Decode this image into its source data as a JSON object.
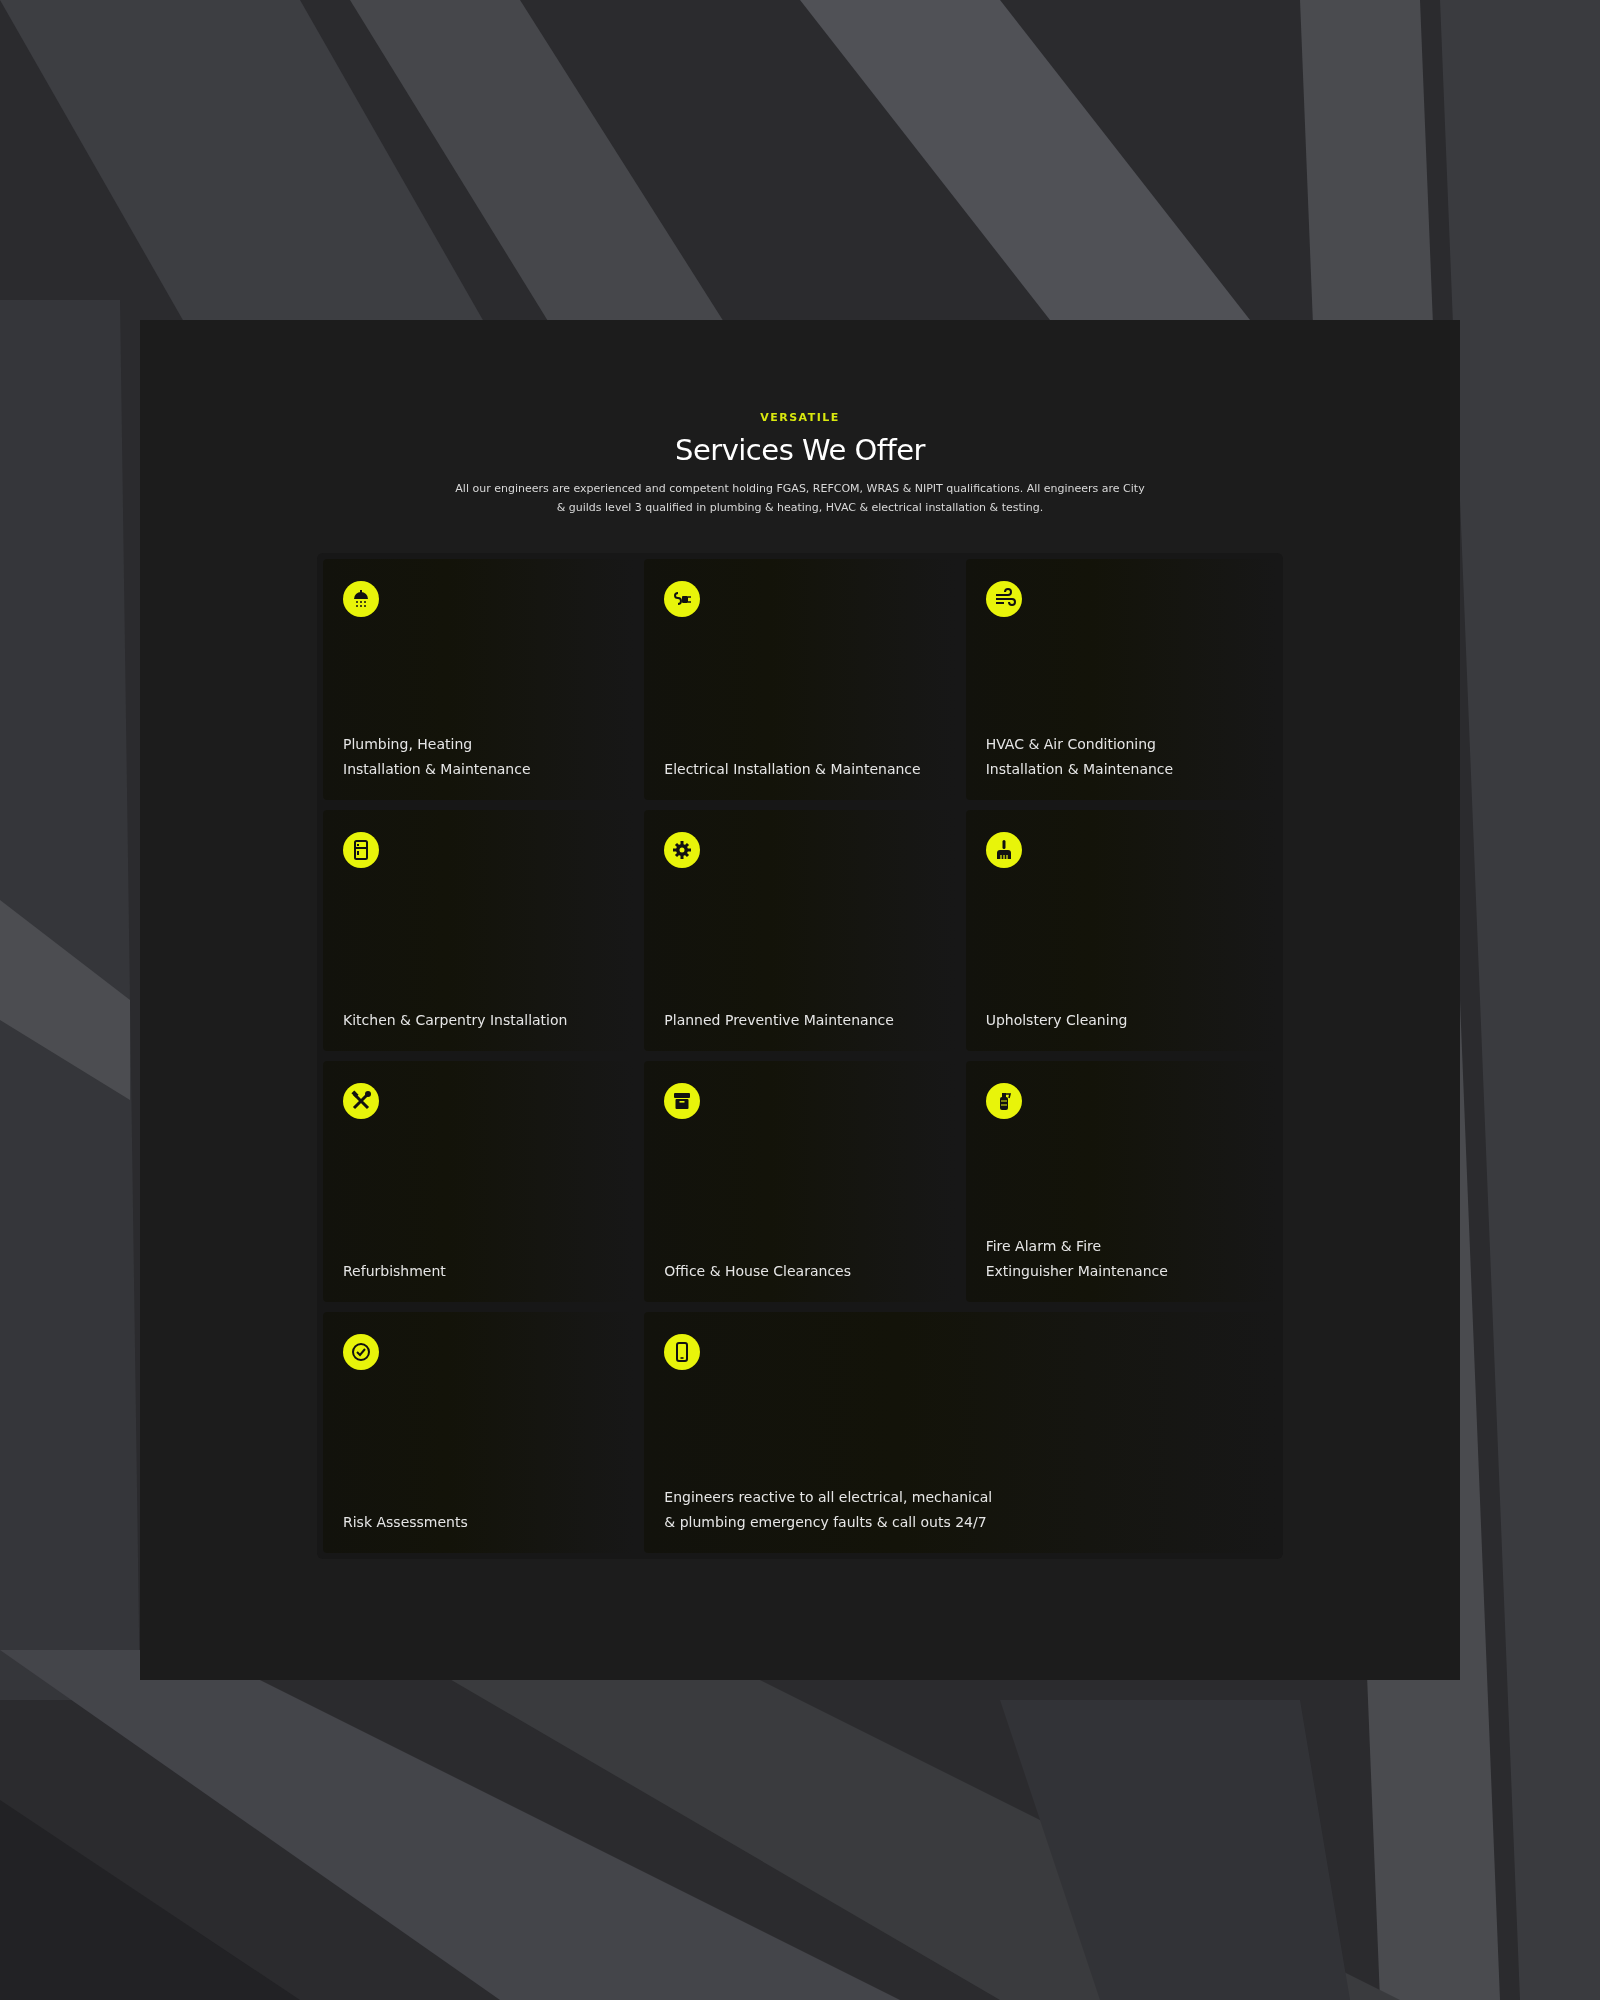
{
  "section": {
    "eyebrow": "VERSATILE",
    "title": "Services We Offer",
    "description": "All our engineers are experienced and competent holding FGAS, REFCOM, WRAS & NIPIT qualifications. All engineers are City & guilds level 3 qualified in plumbing & heating, HVAC & electrical installation & testing."
  },
  "services": [
    {
      "lines": [
        "Plumbing, Heating",
        "Installation & Maintenance"
      ]
    },
    {
      "lines": [
        "Electrical Installation & Maintenance"
      ]
    },
    {
      "lines": [
        "HVAC & Air Conditioning",
        "Installation & Maintenance"
      ]
    },
    {
      "lines": [
        "Kitchen & Carpentry Installation"
      ]
    },
    {
      "lines": [
        "Planned Preventive Maintenance"
      ]
    },
    {
      "lines": [
        "Upholstery Cleaning"
      ]
    },
    {
      "lines": [
        "Refurbishment"
      ]
    },
    {
      "lines": [
        "Office & House Clearances"
      ]
    },
    {
      "lines": [
        "Fire Alarm & Fire",
        "Extinguisher Maintenance"
      ]
    },
    {
      "lines": [
        "Risk Assessments"
      ]
    },
    {
      "lines": [
        "Engineers reactive to all electrical, mechanical",
        "& plumbing emergency faults & call outs 24/7"
      ]
    }
  ]
}
